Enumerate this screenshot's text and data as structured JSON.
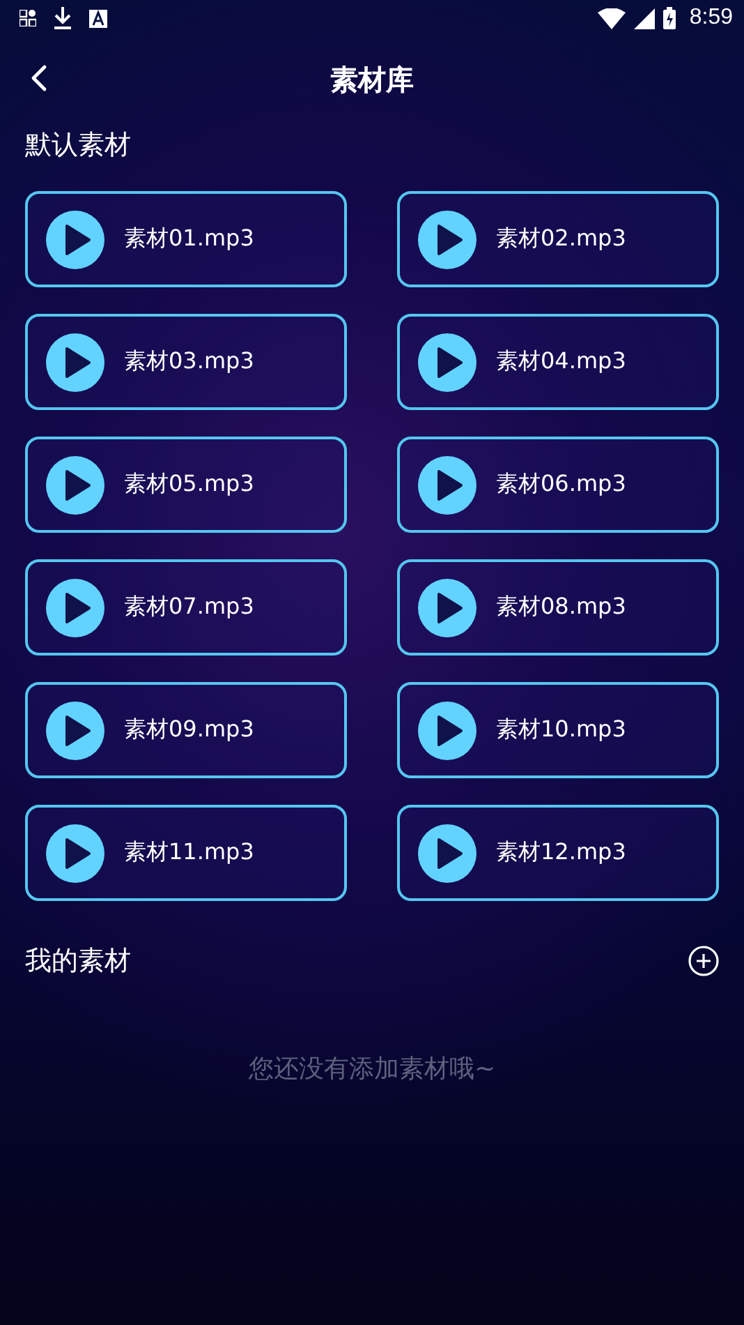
{
  "status_bar": {
    "time": "8:59"
  },
  "header": {
    "title": "素材库"
  },
  "default_section": {
    "title": "默认素材",
    "items": [
      {
        "name": "素材01.mp3"
      },
      {
        "name": "素材02.mp3"
      },
      {
        "name": "素材03.mp3"
      },
      {
        "name": "素材04.mp3"
      },
      {
        "name": "素材05.mp3"
      },
      {
        "name": "素材06.mp3"
      },
      {
        "name": "素材07.mp3"
      },
      {
        "name": "素材08.mp3"
      },
      {
        "name": "素材09.mp3"
      },
      {
        "name": "素材10.mp3"
      },
      {
        "name": "素材11.mp3"
      },
      {
        "name": "素材12.mp3"
      }
    ]
  },
  "my_section": {
    "title": "我的素材",
    "empty_message": "您还没有添加素材哦~"
  }
}
